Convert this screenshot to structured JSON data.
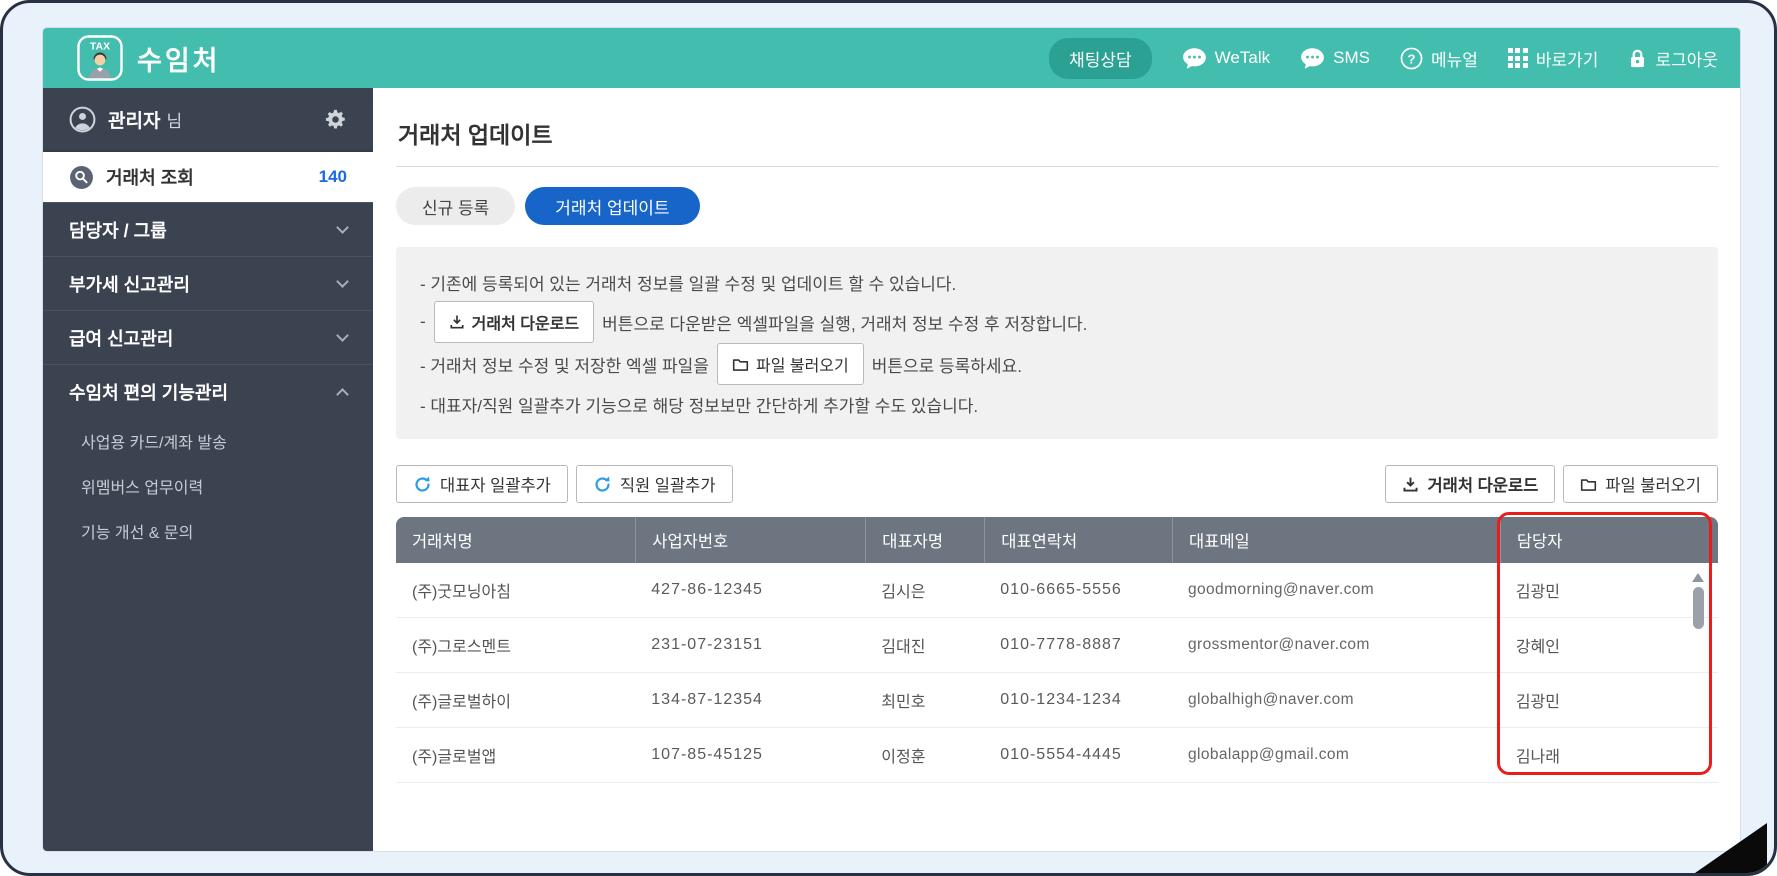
{
  "header": {
    "logo_text": "TAX",
    "app_title": "수임처",
    "chat_button": "채팅상담",
    "menu": [
      {
        "label": "WeTalk"
      },
      {
        "label": "SMS"
      },
      {
        "label": "메뉴얼",
        "glyph": "?"
      },
      {
        "label": "바로가기"
      },
      {
        "label": "로그아웃"
      }
    ]
  },
  "sidebar": {
    "profile": {
      "name": "관리자",
      "suffix": "님"
    },
    "active_item": {
      "label": "거래처 조회",
      "count": "140"
    },
    "menu": [
      {
        "label": "담당자 / 그룹",
        "state": "collapsed"
      },
      {
        "label": "부가세 신고관리",
        "state": "collapsed"
      },
      {
        "label": "급여 신고관리",
        "state": "collapsed"
      },
      {
        "label": "수임처 편의 기능관리",
        "state": "expanded"
      }
    ],
    "submenu": [
      "사업용 카드/계좌 발송",
      "위멤버스 업무이력",
      "기능 개선 & 문의"
    ]
  },
  "main": {
    "page_title": "거래처 업데이트",
    "tabs": [
      {
        "label": "신규 등록",
        "active": false
      },
      {
        "label": "거래처 업데이트",
        "active": true
      }
    ],
    "info": {
      "line1": "- 기존에 등록되어 있는 거래처 정보를 일괄 수정 및 업데이트 할 수 있습니다.",
      "line2_prefix": "-",
      "line2_button": "거래처 다운로드",
      "line2_suffix": "버튼으로 다운받은 엑셀파일을 실행, 거래처 정보 수정 후 저장합니다.",
      "line3_prefix": "- 거래처 정보 수정 및 저장한 엑셀 파일을",
      "line3_button": "파일 불러오기",
      "line3_suffix": "버튼으로 등록하세요.",
      "line4": "- 대표자/직원 일괄추가 기능으로 해당 정보보만 간단하게 추가할 수도 있습니다."
    },
    "actions": {
      "left": [
        "대표자 일괄추가",
        "직원 일괄추가"
      ],
      "right": [
        "거래처 다운로드",
        "파일 불러오기"
      ]
    },
    "table": {
      "columns": [
        "거래처명",
        "사업자번호",
        "대표자명",
        "대표연락처",
        "대표메일",
        "담당자"
      ],
      "rows": [
        [
          "(주)굿모닝아침",
          "427-86-12345",
          "김시은",
          "010-6665-5556",
          "goodmorning@naver.com",
          "김광민"
        ],
        [
          "(주)그로스멘트",
          "231-07-23151",
          "김대진",
          "010-7778-8887",
          "grossmentor@naver.com",
          "강혜인"
        ],
        [
          "(주)글로벌하이",
          "134-87-12354",
          "최민호",
          "010-1234-1234",
          "globalhigh@naver.com",
          "김광민"
        ],
        [
          "(주)글로벌앱",
          "107-85-45125",
          "이정훈",
          "010-5554-4445",
          "globalapp@gmail.com",
          "김나래"
        ]
      ],
      "highlighted_column": "담당자"
    }
  },
  "colors": {
    "topbar_teal": "#43bdad",
    "sidebar_dark": "#3b4250",
    "active_tab_blue": "#1765c8",
    "count_blue": "#1a6be0",
    "table_header_gray": "#6c7580",
    "highlight_red": "#ec1c1c",
    "refresh_icon_blue": "#2e9be6"
  }
}
